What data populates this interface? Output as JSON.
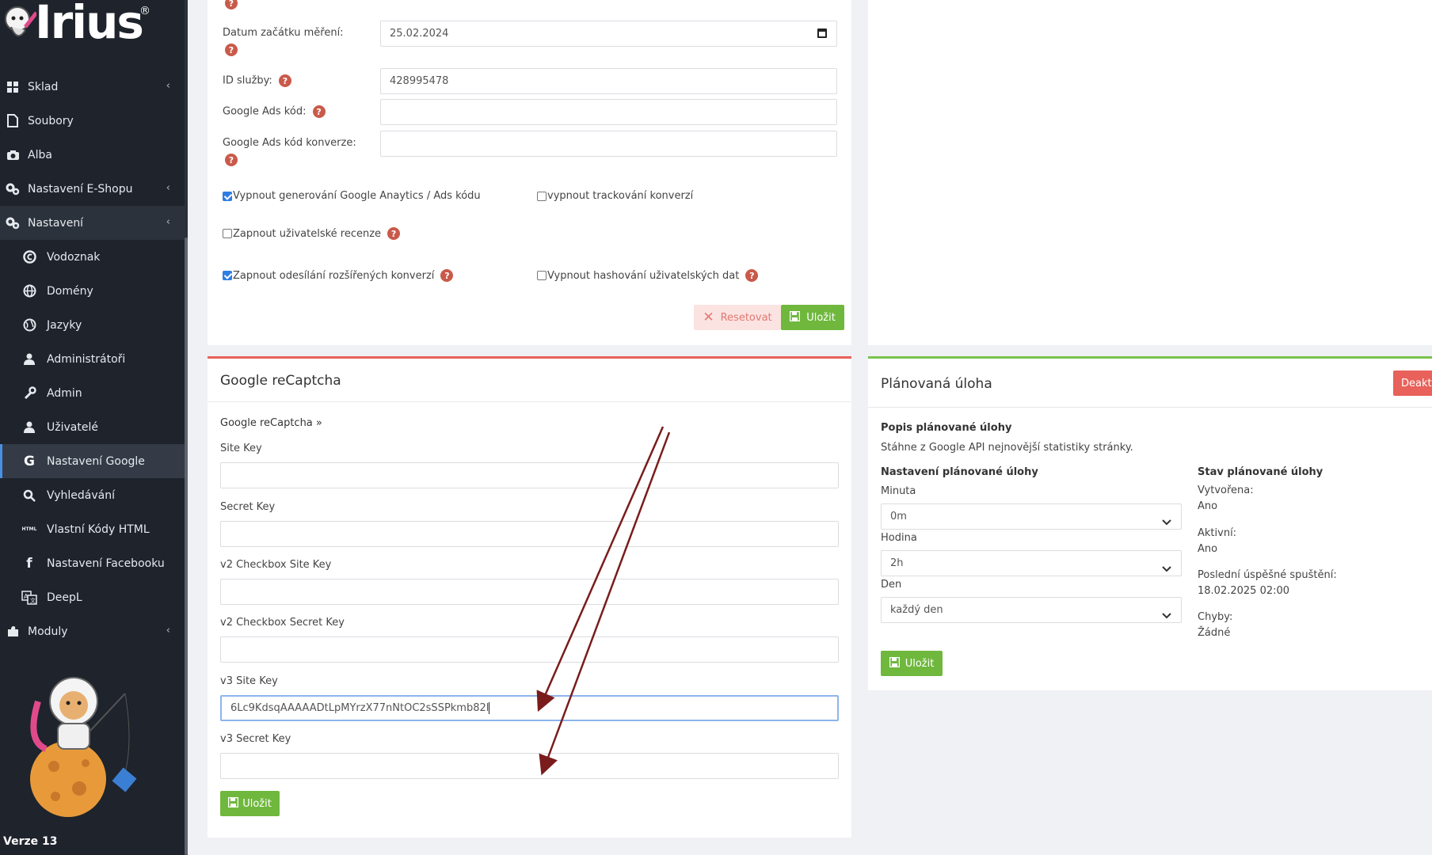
{
  "brand": {
    "logo_text": "Irius",
    "logo_mark": "®",
    "version": "Verze 13"
  },
  "sidebar": {
    "items": [
      {
        "label": "Sklad",
        "icon": "boxes-icon",
        "chevron": "‹",
        "level": 0
      },
      {
        "label": "Soubory",
        "icon": "file-icon",
        "level": 0
      },
      {
        "label": "Alba",
        "icon": "camera-icon",
        "level": 0
      },
      {
        "label": "Nastavení E-Shopu",
        "icon": "cogs-icon",
        "chevron": "‹",
        "level": 0
      },
      {
        "label": "Nastavení",
        "icon": "cogs-icon",
        "chevron": "‹",
        "level": 0,
        "state": "open"
      },
      {
        "label": "Vodoznak",
        "icon": "copyright-icon",
        "level": 1
      },
      {
        "label": "Domény",
        "icon": "globe-icon",
        "level": 1
      },
      {
        "label": "Jazyky",
        "icon": "language-globe-icon",
        "level": 1
      },
      {
        "label": "Administrátoři",
        "icon": "admin-user-icon",
        "level": 1
      },
      {
        "label": "Admin",
        "icon": "wrench-icon",
        "level": 1
      },
      {
        "label": "Uživatelé",
        "icon": "user-icon",
        "level": 1
      },
      {
        "label": "Nastavení Google",
        "icon": "google-icon",
        "level": 1,
        "state": "active"
      },
      {
        "label": "Vyhledávání",
        "icon": "search-icon",
        "level": 1
      },
      {
        "label": "Vlastní Kódy HTML",
        "icon": "html-icon",
        "level": 1
      },
      {
        "label": "Nastavení Facebooku",
        "icon": "facebook-icon",
        "level": 1
      },
      {
        "label": "DeepL",
        "icon": "translate-icon",
        "level": 1
      },
      {
        "label": "Moduly",
        "icon": "puzzle-icon",
        "chevron": "‹",
        "level": 0
      }
    ]
  },
  "analytics_form": {
    "start_date_label": "Datum začátku měření:",
    "start_date_value": "25.02.2024",
    "service_id_label": "ID služby:",
    "service_id_value": "428995478",
    "ads_code_label": "Google Ads kód:",
    "ads_code_value": "",
    "ads_conversion_label": "Google Ads kód konverze:",
    "ads_conversion_value": "",
    "checkboxes": [
      {
        "label": "Vypnout generování Google Anaytics / Ads kódu",
        "checked": true
      },
      {
        "label": "vypnout trackování konverzí",
        "checked": false
      },
      {
        "label": "Zapnout uživatelské recenze",
        "checked": false
      },
      {
        "label": "Zapnout odesílání rozšířených konverzí",
        "checked": true
      },
      {
        "label": "Vypnout hashování uživatelských dat",
        "checked": false
      }
    ],
    "reset_label": "Resetovat",
    "save_label": "Uložit",
    "help_glyph": "?"
  },
  "recaptcha": {
    "title": "Google reCaptcha",
    "breadcrumb": "Google reCaptcha »",
    "fields": [
      {
        "label": "Site Key",
        "value": ""
      },
      {
        "label": "Secret Key",
        "value": ""
      },
      {
        "label": "v2 Checkbox Site Key",
        "value": ""
      },
      {
        "label": "v2 Checkbox Secret Key",
        "value": ""
      },
      {
        "label": "v3 Site Key",
        "value": "6Lc9KdsqAAAAADtLpMYrzX77nNtOC2sSSPkmb82l"
      },
      {
        "label": "v3 Secret Key",
        "value": ""
      }
    ],
    "save_label": "Uložit"
  },
  "task": {
    "title": "Plánovaná úloha",
    "deactivate_label": "Deakt",
    "description_heading": "Popis plánované úlohy",
    "description_text": "Stáhne z Google API nejnovější statistiky stránky.",
    "settings_heading": "Nastavení plánované úlohy",
    "minute_label": "Minuta",
    "minute_value": "0m",
    "hour_label": "Hodina",
    "hour_value": "2h",
    "day_label": "Den",
    "day_value": "každý den",
    "save_label": "Uložit",
    "status_heading": "Stav plánované úlohy",
    "created_label": "Vytvořena:",
    "created_value": "Ano",
    "active_label": "Aktivní:",
    "active_value": "Ano",
    "last_run_label": "Poslední úspěšné spuštění:",
    "last_run_value": "18.02.2025 02:00",
    "errors_label": "Chyby:",
    "errors_value": "Žádné"
  },
  "colors": {
    "sidebar_bg": "#1e232c",
    "save_green": "#6fb83d",
    "danger_red": "#e8615a",
    "help_red": "#c95a4a",
    "annotation_arrow": "#7a1c1c"
  }
}
